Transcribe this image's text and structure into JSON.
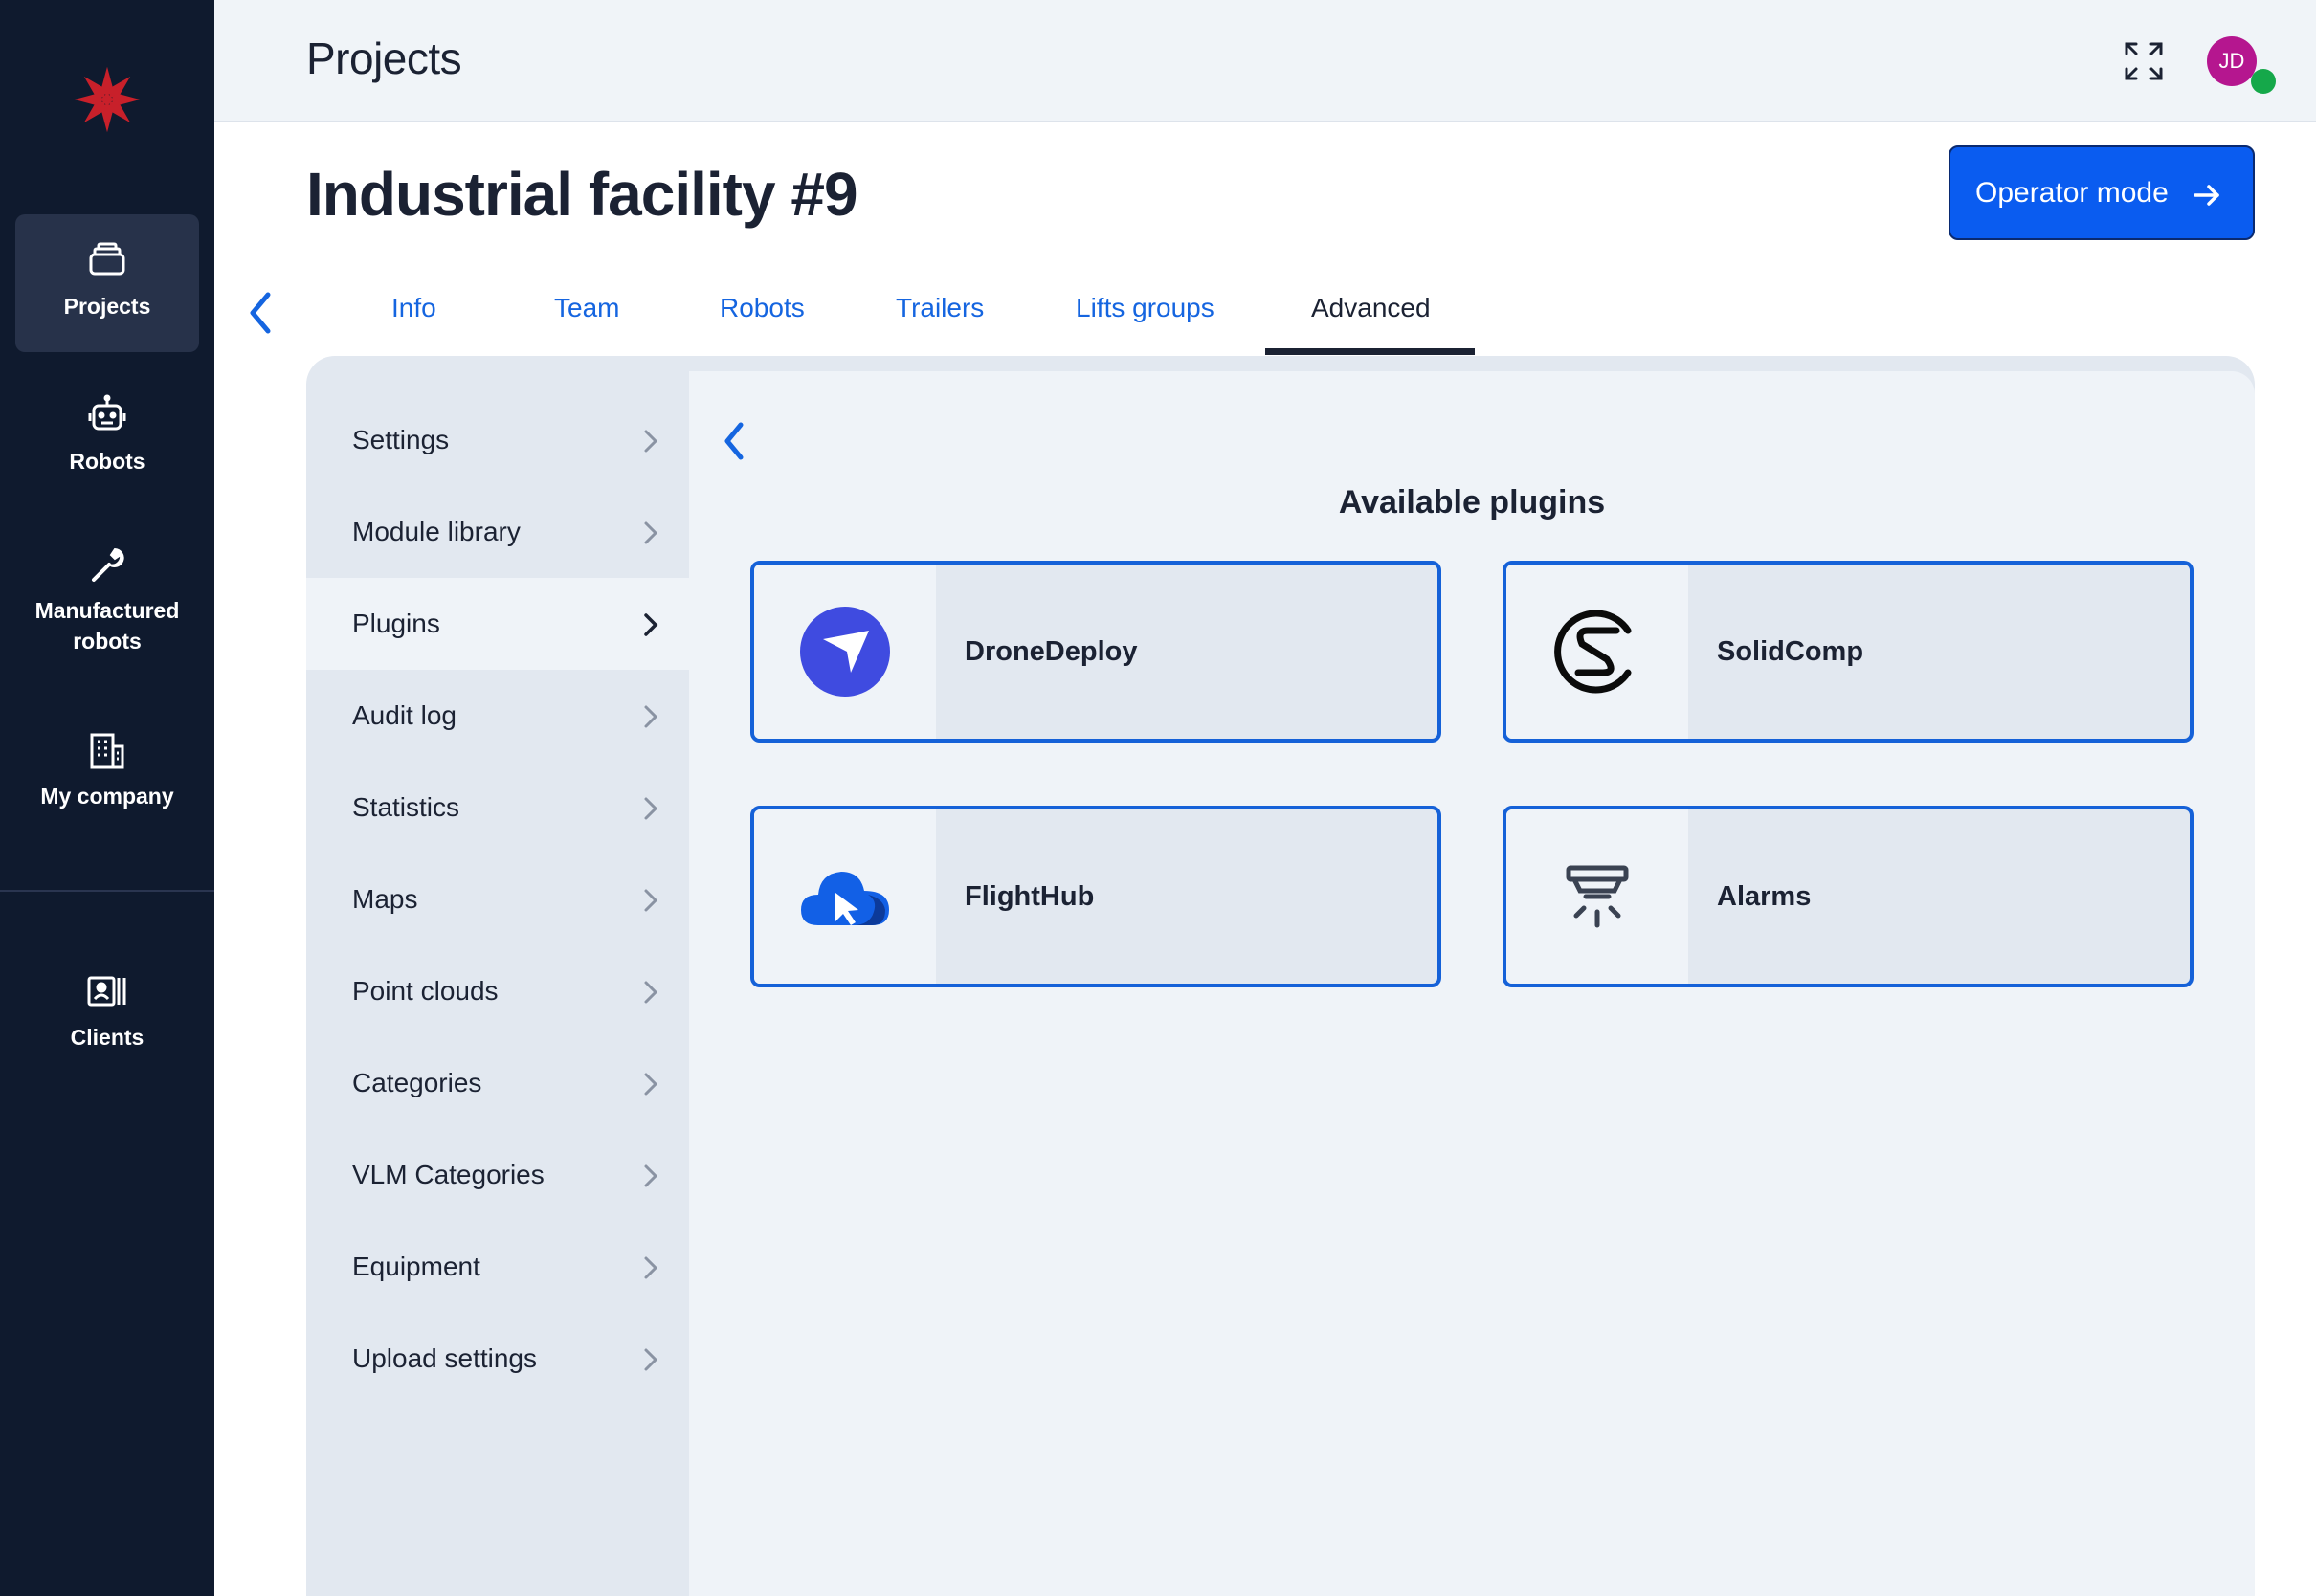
{
  "sidenav": {
    "items": [
      {
        "label": "Projects",
        "icon": "layers-icon",
        "active": true
      },
      {
        "label": "Robots",
        "icon": "robot-icon",
        "active": false
      },
      {
        "label": "Manufactured robots",
        "icon": "wrench-icon",
        "active": false
      },
      {
        "label": "My company",
        "icon": "building-icon",
        "active": false
      },
      {
        "label": "Clients",
        "icon": "id-card-icon",
        "active": false
      }
    ]
  },
  "header": {
    "title": "Projects",
    "avatar_initials": "JD"
  },
  "page": {
    "title": "Industrial facility #9",
    "operator_button": "Operator mode"
  },
  "tabs": [
    {
      "label": "Info"
    },
    {
      "label": "Team"
    },
    {
      "label": "Robots"
    },
    {
      "label": "Trailers"
    },
    {
      "label": "Lifts groups"
    },
    {
      "label": "Advanced",
      "active": true
    }
  ],
  "submenu": [
    {
      "label": "Settings"
    },
    {
      "label": "Module library"
    },
    {
      "label": "Plugins",
      "active": true
    },
    {
      "label": "Audit log"
    },
    {
      "label": "Statistics"
    },
    {
      "label": "Maps"
    },
    {
      "label": "Point clouds"
    },
    {
      "label": "Categories"
    },
    {
      "label": "VLM Categories"
    },
    {
      "label": "Equipment"
    },
    {
      "label": "Upload settings"
    }
  ],
  "plugins": {
    "title": "Available plugins",
    "items": [
      {
        "name": "DroneDeploy",
        "icon": "dronedeploy-logo-icon"
      },
      {
        "name": "SolidComp",
        "icon": "solidcomp-logo-icon"
      },
      {
        "name": "FlightHub",
        "icon": "flighthub-cloud-icon"
      },
      {
        "name": "Alarms",
        "icon": "alarm-siren-icon"
      }
    ]
  },
  "colors": {
    "sidebar_bg": "#0f1a2e",
    "accent": "#0a5cf0",
    "link": "#1565e0",
    "avatar": "#b5168f",
    "status_online": "#15a84a",
    "logo": "#c8202a"
  }
}
